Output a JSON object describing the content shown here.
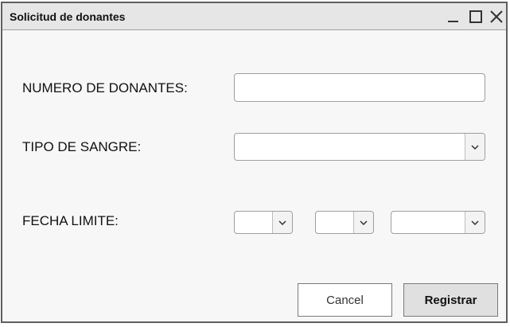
{
  "window": {
    "title": "Solicitud de donantes"
  },
  "form": {
    "num_donantes": {
      "label": "NUMERO DE DONANTES:",
      "value": "",
      "placeholder": ""
    },
    "tipo_sangre": {
      "label": "TIPO DE SANGRE:",
      "selected": ""
    },
    "fecha_limite": {
      "label": "FECHA LIMITE:",
      "day": "",
      "month": "",
      "year": ""
    }
  },
  "buttons": {
    "cancel": "Cancel",
    "register": "Registrar"
  },
  "icons": {
    "minimize": "minimize-icon",
    "maximize": "maximize-icon",
    "close": "close-icon",
    "dropdown": "chevron-down-icon"
  },
  "colors": {
    "window_border": "#5f5f5f",
    "titlebar_bg": "#e6e6e6",
    "content_bg": "#f7f7f7",
    "register_bg": "#e0e0e0"
  }
}
